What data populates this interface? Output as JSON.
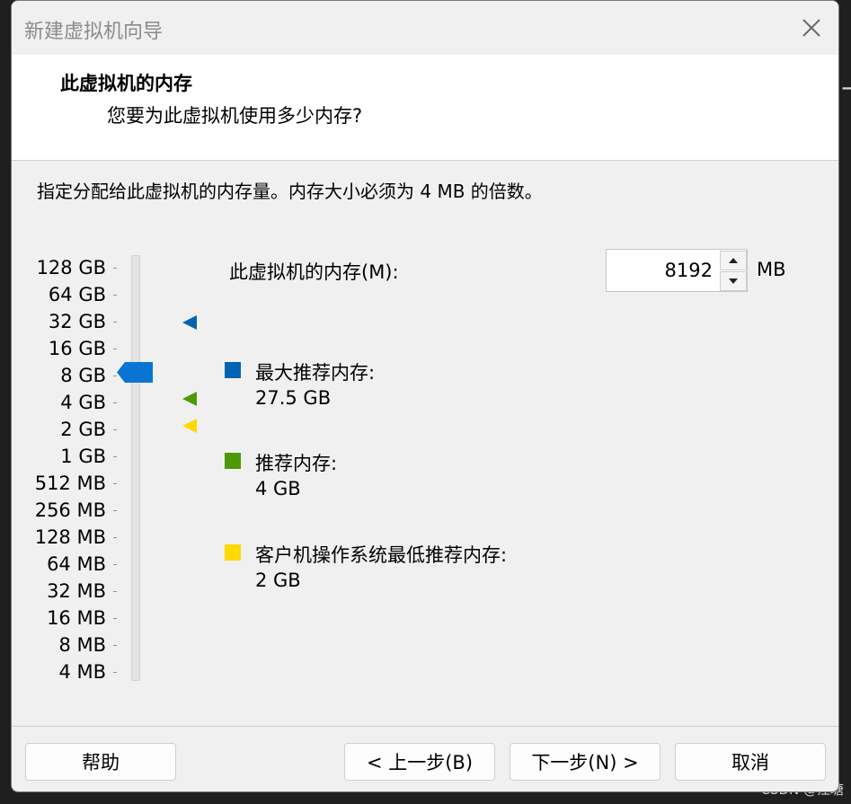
{
  "window": {
    "title": "新建虚拟机向导"
  },
  "header": {
    "title": "此虚拟机的内存",
    "subtitle": "您要为此虚拟机使用多少内存?"
  },
  "instruction": "指定分配给此虚拟机的内存量。内存大小必须为 4 MB 的倍数。",
  "slider": {
    "ticks": [
      "128 GB",
      "64 GB",
      "32 GB",
      "16 GB",
      "8 GB",
      "4 GB",
      "2 GB",
      "1 GB",
      "512 MB",
      "256 MB",
      "128 MB",
      "64 MB",
      "32 MB",
      "16 MB",
      "8 MB",
      "4 MB"
    ],
    "selected": "8 GB"
  },
  "memory": {
    "label": "此虚拟机的内存(M):",
    "value": "8192",
    "unit": "MB"
  },
  "legend": {
    "max": {
      "title": "最大推荐内存:",
      "value": "27.5 GB",
      "color": "#0063b1"
    },
    "recommended": {
      "title": "推荐内存:",
      "value": "4 GB",
      "color": "#4e9a06"
    },
    "minimum": {
      "title": "客户机操作系统最低推荐内存:",
      "value": "2 GB",
      "color": "#ffd800"
    }
  },
  "buttons": {
    "help": "帮助",
    "back": "< 上一步(B)",
    "next": "下一步(N) >",
    "cancel": "取消"
  },
  "watermark": "CSDN @江塘",
  "icons": {
    "close": "close-icon",
    "up": "arrow-up-icon",
    "down": "arrow-down-icon"
  }
}
